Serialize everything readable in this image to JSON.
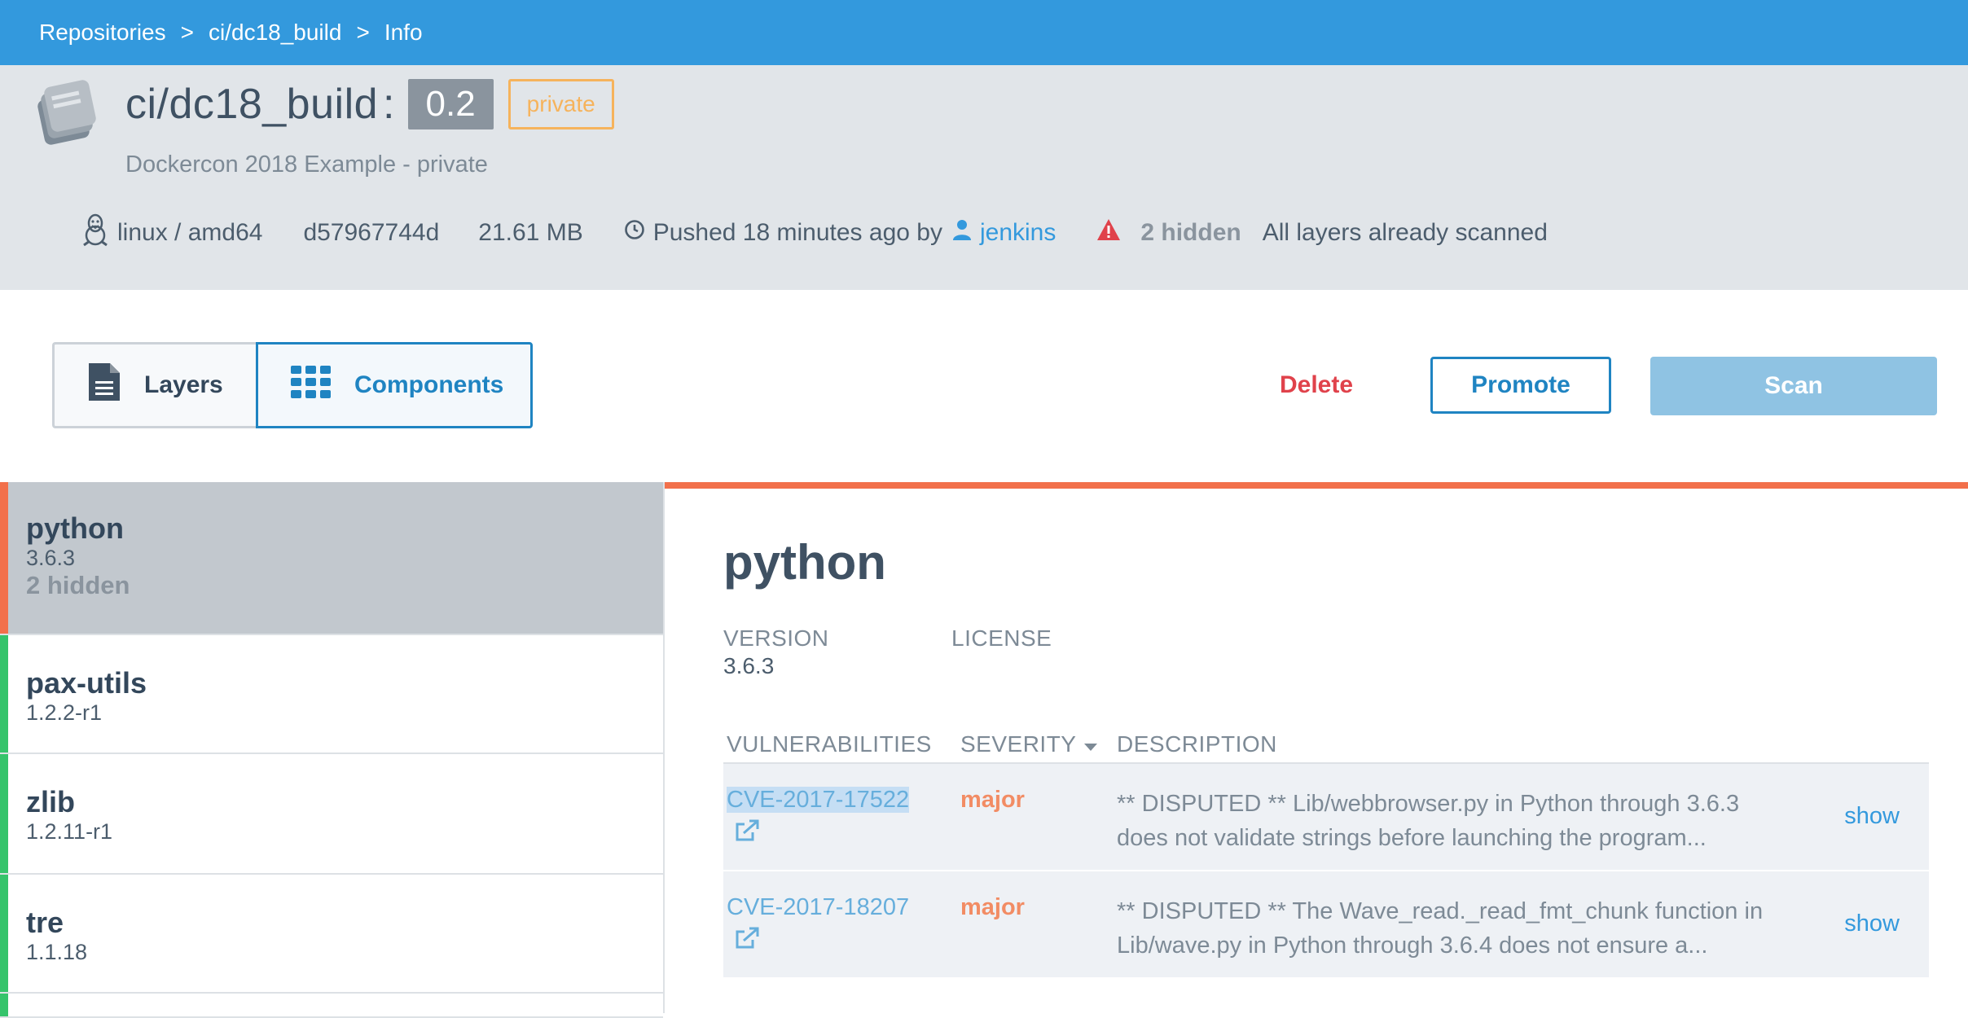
{
  "breadcrumb": {
    "items": [
      "Repositories",
      "ci/dc18_build",
      "Info"
    ],
    "separator": ">"
  },
  "repo": {
    "name": "ci/dc18_build",
    "colon": ":",
    "tag": "0.2",
    "visibility": "private",
    "description": "Dockercon 2018 Example - private"
  },
  "meta": {
    "os_arch": "linux / amd64",
    "digest": "d57967744d",
    "size": "21.61 MB",
    "pushed": "Pushed 18 minutes ago by",
    "user": "jenkins",
    "hidden": "2 hidden",
    "scan_status": "All layers already scanned"
  },
  "toolbar": {
    "layers_label": "Layers",
    "components_label": "Components",
    "delete_label": "Delete",
    "promote_label": "Promote",
    "scan_label": "Scan"
  },
  "components": [
    {
      "name": "python",
      "version": "3.6.3",
      "hidden": "2 hidden",
      "status_color": "#f2704b"
    },
    {
      "name": "pax-utils",
      "version": "1.2.2-r1",
      "status_color": "#35c46b"
    },
    {
      "name": "zlib",
      "version": "1.2.11-r1",
      "status_color": "#35c46b"
    },
    {
      "name": "tre",
      "version": "1.1.18",
      "status_color": "#35c46b"
    },
    {
      "name": "",
      "version": "",
      "status_color": "#35c46b"
    }
  ],
  "detail": {
    "title": "python",
    "version_label": "VERSION",
    "version_value": "3.6.3",
    "license_label": "LICENSE",
    "columns": {
      "vulnerabilities": "VULNERABILITIES",
      "severity": "SEVERITY",
      "description": "DESCRIPTION"
    },
    "rows": [
      {
        "cve": "CVE-2017-17522",
        "severity": "major",
        "description": "** DISPUTED ** Lib/webbrowser.py in Python through 3.6.3 does not validate strings before launching the program...",
        "action": "show"
      },
      {
        "cve": "CVE-2017-18207",
        "severity": "major",
        "description": "** DISPUTED ** The Wave_read._read_fmt_chunk function in Lib/wave.py in Python through 3.6.4 does not ensure a...",
        "action": "show"
      }
    ]
  },
  "colors": {
    "topbar": "#3399dd",
    "accent": "#1f84c2",
    "danger": "#e0424b",
    "critical_bar": "#f2704b",
    "ok_bar": "#35c46b",
    "severity_major": "#f28c64"
  }
}
